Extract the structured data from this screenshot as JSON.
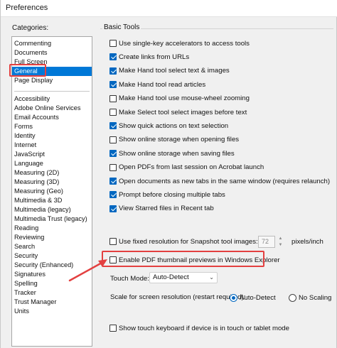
{
  "window": {
    "title": "Preferences"
  },
  "categories": {
    "label": "Categories:",
    "group_top": [
      "Commenting",
      "Documents",
      "Full Screen",
      "General",
      "Page Display"
    ],
    "group_bottom": [
      "Accessibility",
      "Adobe Online Services",
      "Email Accounts",
      "Forms",
      "Identity",
      "Internet",
      "JavaScript",
      "Language",
      "Measuring (2D)",
      "Measuring (3D)",
      "Measuring (Geo)",
      "Multimedia & 3D",
      "Multimedia (legacy)",
      "Multimedia Trust (legacy)",
      "Reading",
      "Reviewing",
      "Search",
      "Security",
      "Security (Enhanced)",
      "Signatures",
      "Spelling",
      "Tracker",
      "Trust Manager",
      "Units"
    ],
    "selected": "General"
  },
  "basic_tools": {
    "title": "Basic Tools",
    "options": [
      {
        "label": "Use single-key accelerators to access tools",
        "checked": false
      },
      {
        "label": "Create links from URLs",
        "checked": true
      },
      {
        "label": "Make Hand tool select text & images",
        "checked": true
      },
      {
        "label": "Make Hand tool read articles",
        "checked": true
      },
      {
        "label": "Make Hand tool use mouse-wheel zooming",
        "checked": false
      },
      {
        "label": "Make Select tool select images before text",
        "checked": false
      },
      {
        "label": "Show quick actions on text selection",
        "checked": true
      },
      {
        "label": "Show online storage when opening files",
        "checked": false
      },
      {
        "label": "Show online storage when saving files",
        "checked": true
      },
      {
        "label": "Open PDFs from last session on Acrobat launch",
        "checked": false
      },
      {
        "label": "Open documents as new tabs in the same window (requires relaunch)",
        "checked": true
      },
      {
        "label": "Prompt before closing multiple tabs",
        "checked": true
      },
      {
        "label": "View Starred files in Recent tab",
        "checked": true
      }
    ]
  },
  "snapshot": {
    "label": "Use fixed resolution for Snapshot tool images:",
    "checked": false,
    "value": "72",
    "unit": "pixels/inch"
  },
  "thumbnail": {
    "label": "Enable PDF thumbnail previews in Windows Explorer",
    "checked": false
  },
  "touch_mode": {
    "label": "Touch Mode:",
    "value": "Auto-Detect"
  },
  "scale": {
    "label": "Scale for screen resolution (restart required):",
    "options": [
      {
        "label": "Auto-Detect",
        "selected": true
      },
      {
        "label": "No Scaling",
        "selected": false
      }
    ]
  },
  "touch_keyboard": {
    "label": "Show touch keyboard if device is in touch or tablet mode",
    "checked": false
  },
  "colors": {
    "selection": "#0078d7",
    "checkbox": "#0067c0",
    "highlight": "#e34040"
  }
}
